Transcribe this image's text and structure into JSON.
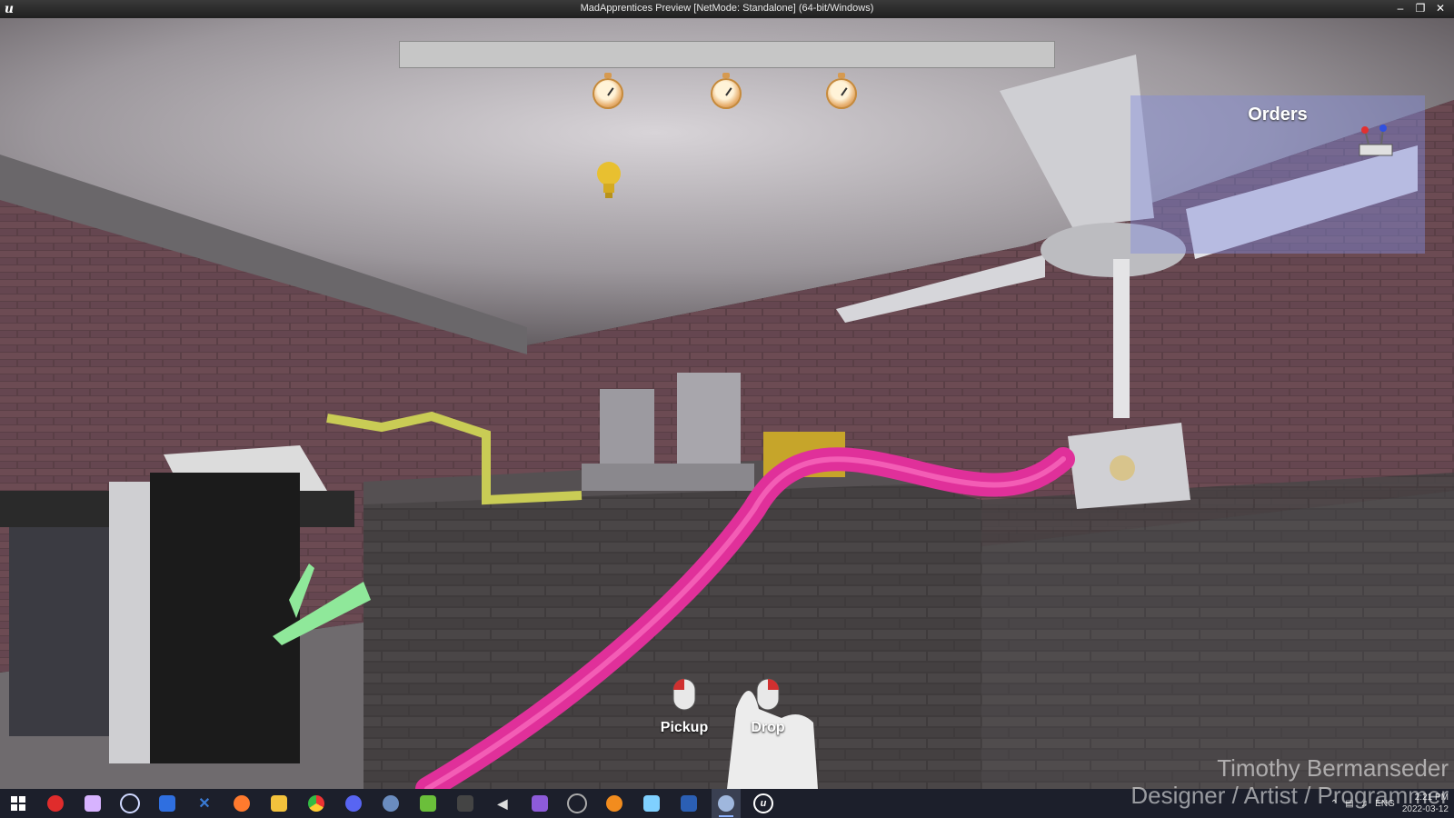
{
  "window": {
    "title": "MadApprentices Preview [NetMode: Standalone]  (64-bit/Windows)",
    "controls": [
      "minimize",
      "maximize",
      "close"
    ]
  },
  "hud": {
    "order_progress_fraction": 0.0,
    "timers": [
      {
        "icon": "stopwatch-icon"
      },
      {
        "icon": "stopwatch-icon"
      },
      {
        "icon": "stopwatch-icon"
      }
    ],
    "hint_icon": "lightbulb-icon",
    "orders": {
      "title": "Orders",
      "items": [
        {
          "icon": "control-box-icon"
        }
      ]
    },
    "mouse_hints": [
      {
        "label": "Pickup",
        "button": "left"
      },
      {
        "label": "Drop",
        "button": "right"
      }
    ]
  },
  "credit": {
    "name": "Timothy Bermanseder",
    "role": "Designer / Artist / Programmer"
  },
  "taskbar": {
    "items": [
      {
        "name": "start",
        "color": "#ffffff"
      },
      {
        "name": "app-red",
        "color": "#e02c2c"
      },
      {
        "name": "app-cloud",
        "color": "#d7b3ff"
      },
      {
        "name": "app-lock",
        "color": "#cfd8ff"
      },
      {
        "name": "bitwarden",
        "color": "#2f6fe0"
      },
      {
        "name": "app-blue-x",
        "color": "#3a7bd5"
      },
      {
        "name": "browser-firefox",
        "color": "#ff7a2e"
      },
      {
        "name": "file-explorer",
        "color": "#f3c23c"
      },
      {
        "name": "chrome",
        "color": "#3bb04b"
      },
      {
        "name": "discord",
        "color": "#5865f2"
      },
      {
        "name": "steam",
        "color": "#6a8cbf"
      },
      {
        "name": "notepad-plus",
        "color": "#6bbf3a"
      },
      {
        "name": "epic-games",
        "color": "#444444"
      },
      {
        "name": "app-arrow",
        "color": "#dddddd"
      },
      {
        "name": "visual-studio",
        "color": "#8d5bd9"
      },
      {
        "name": "app-circle",
        "color": "#aaaaaa"
      },
      {
        "name": "blender",
        "color": "#f28c1e"
      },
      {
        "name": "app-doc",
        "color": "#7fd0ff"
      },
      {
        "name": "word",
        "color": "#2b5fb4"
      },
      {
        "name": "steam-active",
        "color": "#9fb7dd"
      },
      {
        "name": "unreal",
        "color": "#ffffff"
      }
    ],
    "tray": {
      "language": "ENG",
      "time": "2:21 PM",
      "date": "2022-03-12"
    }
  }
}
